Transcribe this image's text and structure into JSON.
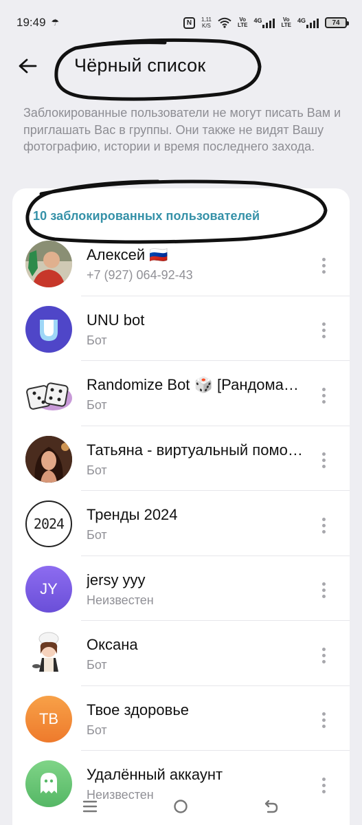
{
  "status_bar": {
    "time": "19:49",
    "net_speed_top": "1,11",
    "net_speed_bottom": "K/S",
    "sim1_top": "Vo",
    "sim1_bottom": "LTE",
    "sim1_gen": "4G",
    "sim2_top": "Vo",
    "sim2_bottom": "LTE",
    "sim2_gen": "4G",
    "battery": "74",
    "nfc_label": "N"
  },
  "header": {
    "title": "Чёрный список"
  },
  "description": "Заблокированные пользователи не могут писать Вам и приглашать Вас в группы. Они также не видят Вашу фотографию, истории и время последнего захода.",
  "blocked_count_label": "10 заблокированных пользователей",
  "users": [
    {
      "name": "Алексей 🇷🇺",
      "subtitle": "+7 (927) 064-92-43",
      "avatar": {
        "type": "photo",
        "color": "#b23a2e"
      }
    },
    {
      "name": "UNU bot",
      "subtitle": "Бот",
      "avatar": {
        "type": "logo",
        "color": "#4f46c8"
      }
    },
    {
      "name": "Randomize Bot 🎲 [Рандомайзер]",
      "subtitle": "Бот",
      "avatar": {
        "type": "dice",
        "color": "#ffffff"
      }
    },
    {
      "name": "Татьяна - виртуальный помощник",
      "subtitle": "Бот",
      "avatar": {
        "type": "photo",
        "color": "#5a3424"
      }
    },
    {
      "name": "Тренды 2024",
      "subtitle": "Бот",
      "avatar": {
        "type": "text",
        "text": "2024",
        "color": "#ffffff"
      }
    },
    {
      "name": "jersy yyy",
      "subtitle": "Неизвестен",
      "avatar": {
        "type": "initials",
        "text": "JY",
        "color": "#7b5ce6"
      }
    },
    {
      "name": "Оксана",
      "subtitle": "Бот",
      "avatar": {
        "type": "chef",
        "color": "#ffffff"
      }
    },
    {
      "name": "Твое здоровье",
      "subtitle": "Бот",
      "avatar": {
        "type": "initials",
        "text": "ТВ",
        "color": "#f3893a"
      }
    },
    {
      "name": "Удалённый аккаунт",
      "subtitle": "Неизвестен",
      "avatar": {
        "type": "ghost",
        "color": "#6cc37a"
      }
    }
  ],
  "colors": {
    "accent": "#3591a8",
    "background": "#eeeef2"
  }
}
